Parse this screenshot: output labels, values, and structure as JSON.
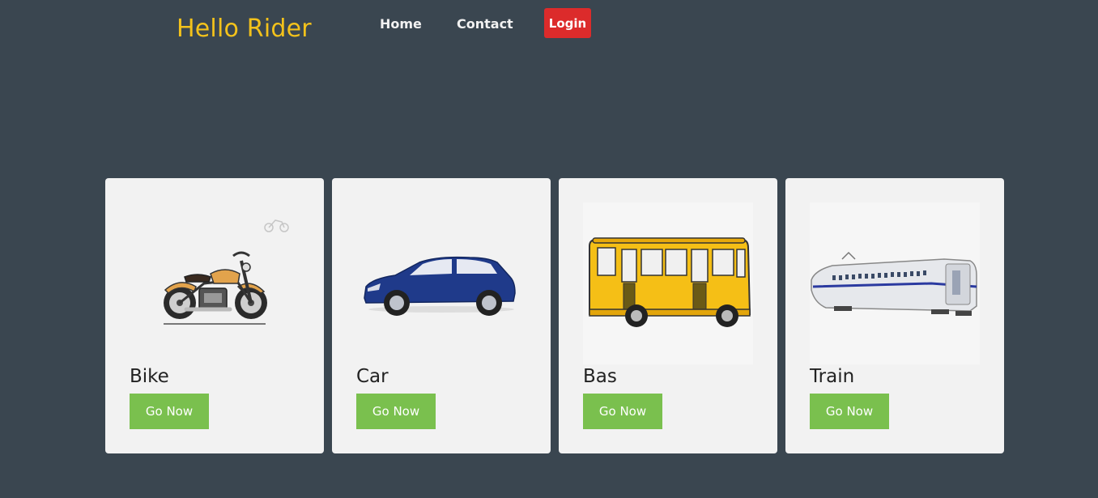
{
  "header": {
    "brand": "Hello Rider",
    "nav": {
      "home": "Home",
      "contact": "Contact"
    },
    "login_label": "Login"
  },
  "cards": [
    {
      "title": "Bike",
      "button_label": "Go Now",
      "icon": "motorcycle-icon"
    },
    {
      "title": "Car",
      "button_label": "Go Now",
      "icon": "car-icon"
    },
    {
      "title": "Bas",
      "button_label": "Go Now",
      "icon": "bus-icon"
    },
    {
      "title": "Train",
      "button_label": "Go Now",
      "icon": "train-icon"
    }
  ],
  "colors": {
    "background": "#3a4650",
    "brand": "#f3c21b",
    "login": "#dc2b2b",
    "card": "#f2f2f2",
    "go_button": "#7ac04e"
  }
}
